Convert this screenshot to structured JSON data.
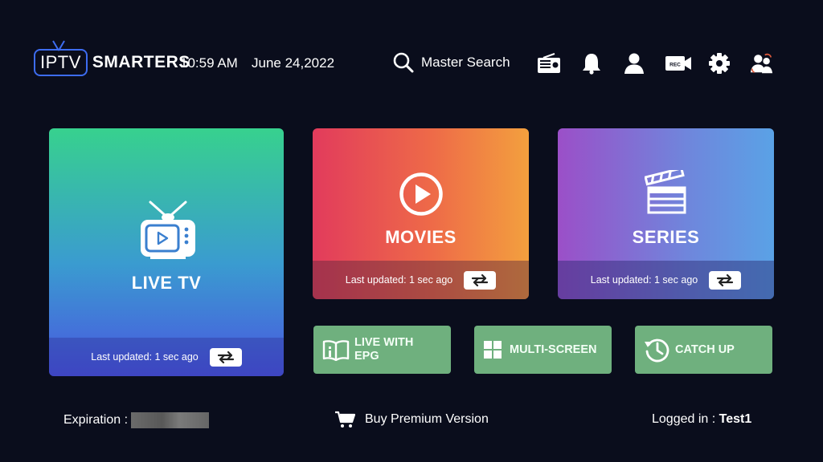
{
  "header": {
    "logo_iptv": "IPTV",
    "logo_smarters": "SMARTERS",
    "time": "10:59 AM",
    "date": "June 24,2022",
    "search_label": "Master Search",
    "icons": [
      "radio-icon",
      "bell-icon",
      "user-icon",
      "record-icon",
      "gear-icon",
      "switch-user-icon"
    ]
  },
  "tiles": {
    "live": {
      "label": "LIVE TV",
      "updated": "Last updated: 1 sec ago"
    },
    "movies": {
      "label": "MOVIES",
      "updated": "Last updated: 1 sec ago"
    },
    "series": {
      "label": "SERIES",
      "updated": "Last updated: 1 sec ago"
    }
  },
  "quick": {
    "epg_line1": "LIVE WITH",
    "epg_line2": "EPG",
    "multiscreen": "MULTI-SCREEN",
    "catchup": "CATCH UP"
  },
  "footer": {
    "expiration_label": "Expiration :",
    "buy_label": "Buy Premium Version",
    "logged_label": "Logged in :",
    "username": "Test1"
  },
  "colors": {
    "background": "#0a0d1c",
    "quick_tile": "#6fb07e",
    "logo_accent": "#3d6cf0"
  }
}
